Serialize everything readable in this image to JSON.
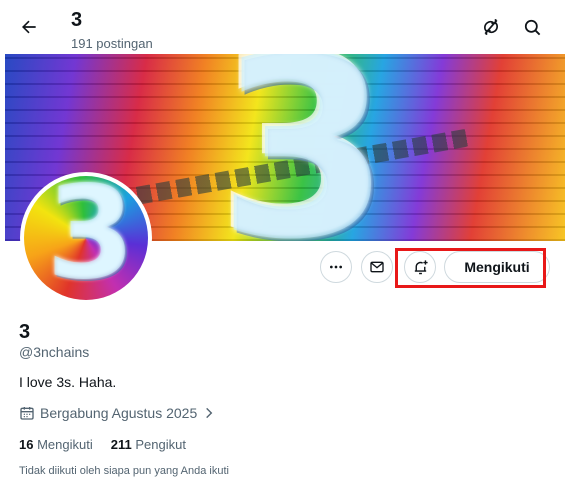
{
  "header": {
    "title": "3",
    "subtitle": "191 postingan"
  },
  "profile": {
    "name": "3",
    "handle": "@3nchains",
    "bio": "I love 3s. Haha.",
    "joined": "Bergabung Agustus 2025",
    "following_count": "16",
    "following_label": "Mengikuti",
    "followers_count": "211",
    "followers_label": "Pengikut",
    "mutual_note": "Tidak diikuti oleh siapa pun yang Anda ikuti"
  },
  "banner": {
    "text": "3"
  },
  "avatar": {
    "text": "3"
  },
  "actions": {
    "follow_label": "Mengikuti"
  },
  "icons": [
    "back-arrow-icon",
    "refresh-icon",
    "search-icon",
    "more-icon",
    "mail-icon",
    "bell-plus-icon",
    "calendar-icon",
    "chevron-right-icon"
  ],
  "colors": {
    "text_primary": "#0f1419",
    "text_secondary": "#536471",
    "border": "#cfd9de",
    "highlight": "#e81818"
  }
}
